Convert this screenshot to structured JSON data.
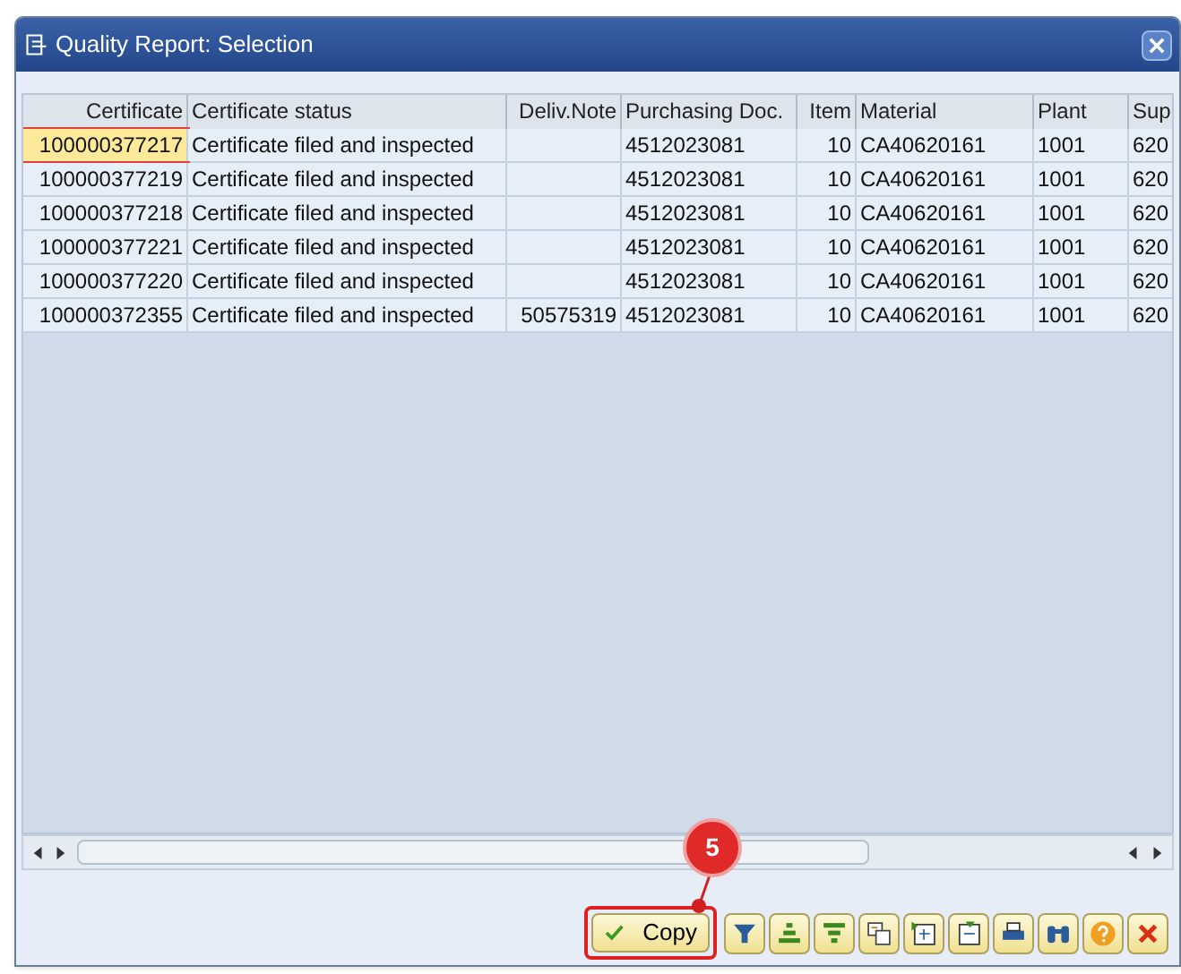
{
  "window": {
    "title": "Quality Report: Selection"
  },
  "table": {
    "columns": [
      "Certificate",
      "Certificate status",
      "Deliv.Note",
      "Purchasing Doc.",
      "Item",
      "Material",
      "Plant",
      "Sup"
    ],
    "rows": [
      {
        "selected": true,
        "cells": [
          "100000377217",
          "Certificate filed and inspected",
          "",
          "4512023081",
          "10",
          "CA40620161",
          "1001",
          "620"
        ]
      },
      {
        "selected": false,
        "cells": [
          "100000377219",
          "Certificate filed and inspected",
          "",
          "4512023081",
          "10",
          "CA40620161",
          "1001",
          "620"
        ]
      },
      {
        "selected": false,
        "cells": [
          "100000377218",
          "Certificate filed and inspected",
          "",
          "4512023081",
          "10",
          "CA40620161",
          "1001",
          "620"
        ]
      },
      {
        "selected": false,
        "cells": [
          "100000377221",
          "Certificate filed and inspected",
          "",
          "4512023081",
          "10",
          "CA40620161",
          "1001",
          "620"
        ]
      },
      {
        "selected": false,
        "cells": [
          "100000377220",
          "Certificate filed and inspected",
          "",
          "4512023081",
          "10",
          "CA40620161",
          "1001",
          "620"
        ]
      },
      {
        "selected": false,
        "cells": [
          "100000372355",
          "Certificate filed and inspected",
          "50575319",
          "4512023081",
          "10",
          "CA40620161",
          "1001",
          "620"
        ]
      }
    ]
  },
  "toolbar": {
    "copy_button": "Copy",
    "tools": [
      {
        "kind": "filter"
      },
      {
        "kind": "sort-up"
      },
      {
        "kind": "sort-down"
      },
      {
        "kind": "copy-layout"
      },
      {
        "kind": "insert"
      },
      {
        "kind": "delete"
      },
      {
        "kind": "print"
      },
      {
        "kind": "find"
      },
      {
        "kind": "help"
      },
      {
        "kind": "cancel"
      }
    ]
  },
  "callout": {
    "label": "5"
  }
}
